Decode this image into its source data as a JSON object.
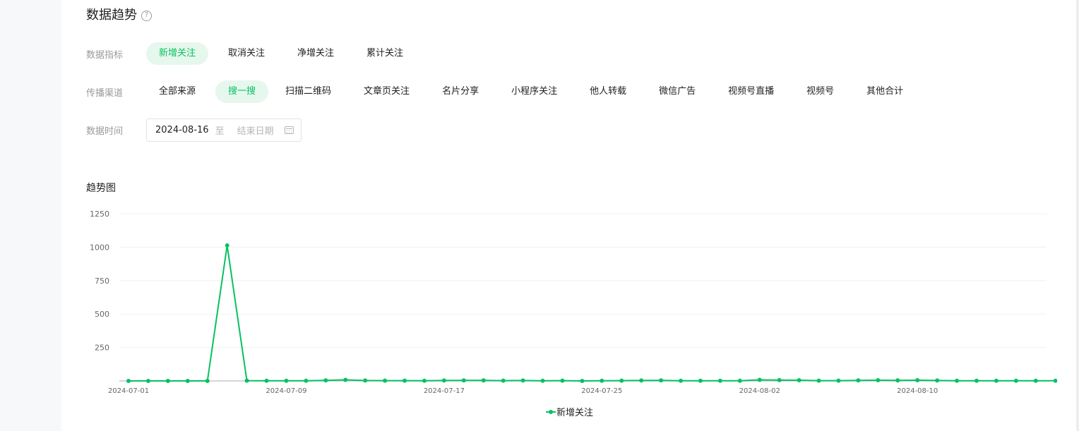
{
  "section": {
    "title": "数据趋势",
    "help_icon": "?"
  },
  "filters": {
    "indicator": {
      "label": "数据指标",
      "options": [
        "新增关注",
        "取消关注",
        "净增关注",
        "累计关注"
      ],
      "selected": "新增关注"
    },
    "channel": {
      "label": "传播渠道",
      "options": [
        "全部来源",
        "搜一搜",
        "扫描二维码",
        "文章页关注",
        "名片分享",
        "小程序关注",
        "他人转载",
        "微信广告",
        "视频号直播",
        "视频号",
        "其他合计"
      ],
      "selected": "搜一搜"
    },
    "time": {
      "label": "数据时间",
      "start": "2024-08-16",
      "separator": "至",
      "end_placeholder": "结束日期"
    }
  },
  "chart_section_title": "趋势图",
  "colors": {
    "accent": "#07c160",
    "accent_bg": "#e6f7ee",
    "muted": "#9a9a9a"
  },
  "chart_data": {
    "type": "line",
    "title": "趋势图",
    "xlabel": "",
    "ylabel": "",
    "ylim": [
      0,
      1250
    ],
    "yticks": [
      1250,
      1000,
      750,
      500,
      250
    ],
    "grid": true,
    "legend_position": "bottom-center",
    "x": [
      "2024-07-01",
      "2024-07-02",
      "2024-07-03",
      "2024-07-04",
      "2024-07-05",
      "2024-07-06",
      "2024-07-07",
      "2024-07-08",
      "2024-07-09",
      "2024-07-10",
      "2024-07-11",
      "2024-07-12",
      "2024-07-13",
      "2024-07-14",
      "2024-07-15",
      "2024-07-16",
      "2024-07-17",
      "2024-07-18",
      "2024-07-19",
      "2024-07-20",
      "2024-07-21",
      "2024-07-22",
      "2024-07-23",
      "2024-07-24",
      "2024-07-25",
      "2024-07-26",
      "2024-07-27",
      "2024-07-28",
      "2024-07-29",
      "2024-07-30",
      "2024-07-31",
      "2024-08-01",
      "2024-08-02",
      "2024-08-03",
      "2024-08-04",
      "2024-08-05",
      "2024-08-06",
      "2024-08-07",
      "2024-08-08",
      "2024-08-09",
      "2024-08-10",
      "2024-08-11",
      "2024-08-12",
      "2024-08-13",
      "2024-08-14",
      "2024-08-15",
      "2024-08-16",
      "2024-08-17"
    ],
    "xtick_labels": [
      "2024-07-01",
      "2024-07-09",
      "2024-07-17",
      "2024-07-25",
      "2024-08-02",
      "2024-08-10"
    ],
    "series": [
      {
        "name": "新增关注",
        "color": "#07c160",
        "values": [
          0,
          0,
          0,
          0,
          0,
          1013,
          2,
          1,
          1,
          1,
          4,
          8,
          3,
          2,
          2,
          1,
          3,
          4,
          4,
          2,
          3,
          1,
          2,
          0,
          1,
          2,
          3,
          4,
          1,
          1,
          1,
          1,
          8,
          6,
          5,
          2,
          2,
          4,
          5,
          4,
          5,
          3,
          1,
          1,
          1,
          1,
          1,
          1
        ]
      }
    ]
  }
}
